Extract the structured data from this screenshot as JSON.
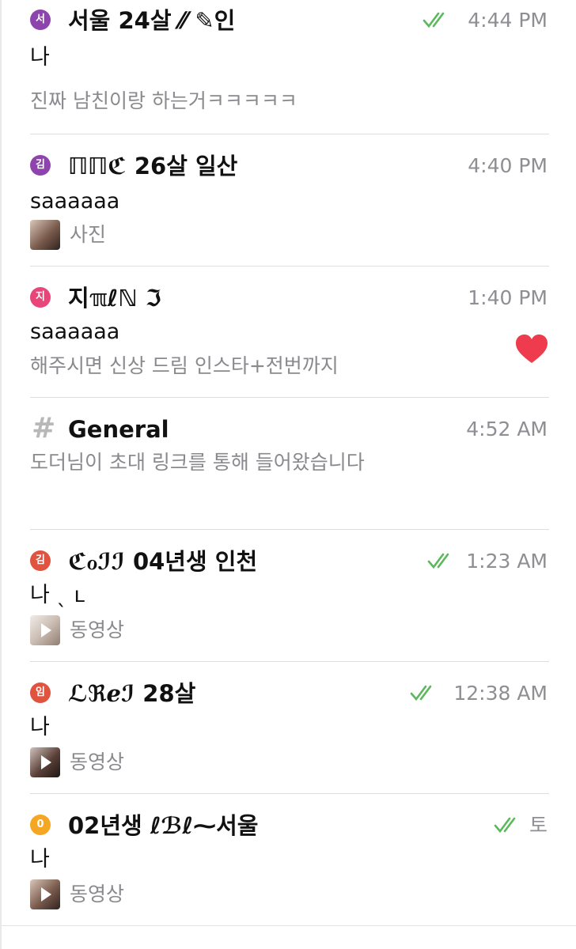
{
  "colors": {
    "check_green": "#5cb85c",
    "heart_red": "#ee3b4d",
    "muted_text": "#8a8a8e",
    "time_text": "#8e8e93"
  },
  "chats": [
    {
      "avatar_letter": "서",
      "avatar_color": "#8e44ad",
      "title": "서울 24살 ⁄⁄ ✎인",
      "time": "4:44 PM",
      "read_checks": true,
      "sender": "나",
      "preview": "진짜 남친이랑 하는거ㅋㅋㅋㅋㅋ"
    },
    {
      "avatar_letter": "김",
      "avatar_color": "#8e44ad",
      "title": "ℿℿℭ 26살 일산",
      "time": "4:40 PM",
      "read_checks": false,
      "sender": "saaaaaa",
      "preview": "사진",
      "thumb_icon": "photo-thumbnail"
    },
    {
      "avatar_letter": "지",
      "avatar_color": "#e8457a",
      "title": "지ℼℓℕ ℑ",
      "time": "1:40 PM",
      "read_checks": false,
      "sender": "saaaaaa",
      "preview": "해주시면 신상 드림 인스타+전번까지",
      "reaction_icon": "heart-icon"
    },
    {
      "channel_icon": "hash-icon",
      "title": "General",
      "time": "4:52 AM",
      "read_checks": false,
      "preview": "도더님이 초대 링크를 통해 들어왔습니다"
    },
    {
      "avatar_letter": "김",
      "avatar_color": "#e0533f",
      "title": "ℭℴℐℐ 04년생 인천",
      "time": "1:23 AM",
      "read_checks": true,
      "sender": "나 ˎ ʟ",
      "preview": "동영상",
      "thumb_icon": "video-thumbnail"
    },
    {
      "avatar_letter": "임",
      "avatar_color": "#e0533f",
      "title": "ℒℜℯℐ 28살",
      "time": "12:38 AM",
      "read_checks": true,
      "sender": "나",
      "preview": "동영상",
      "thumb_icon": "video-thumbnail"
    },
    {
      "avatar_letter": "0",
      "avatar_color": "#f5a623",
      "title": "02년생 ℓℬℓ⁓서울",
      "time": "토",
      "read_checks": true,
      "sender": "나",
      "preview": "동영상",
      "thumb_icon": "video-thumbnail"
    }
  ]
}
